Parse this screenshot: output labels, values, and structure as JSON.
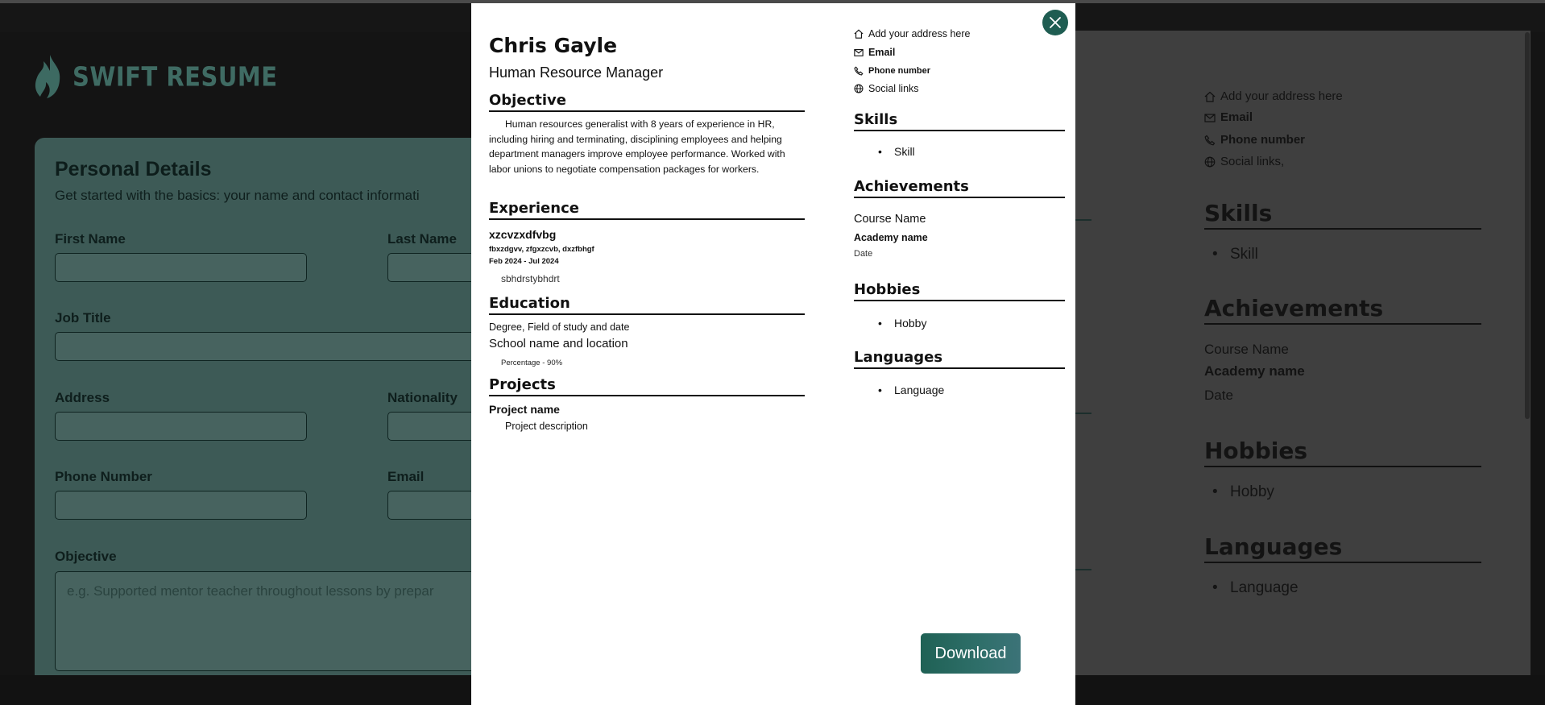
{
  "app": {
    "brand": "SWIFT RESUME"
  },
  "form": {
    "title": "Personal Details",
    "subtitle": "Get started with the basics: your name and contact informati",
    "fields": {
      "first_name": "First Name",
      "last_name": "Last Name",
      "job_title": "Job Title",
      "address": "Address",
      "nationality": "Nationality",
      "phone": "Phone Number",
      "email": "Email",
      "objective": "Objective"
    },
    "objective_placeholder": "e.g. Supported mentor teacher throughout lessons by prepar"
  },
  "preview": {
    "contact": {
      "address": "Add your address here",
      "email": "Email",
      "phone": "Phone number",
      "social": "Social links,"
    },
    "skills": {
      "heading": "Skills",
      "items": [
        "Skill"
      ]
    },
    "achievements": {
      "heading": "Achievements",
      "course": "Course Name",
      "academy": "Academy name",
      "date": "Date"
    },
    "hobbies": {
      "heading": "Hobbies",
      "items": [
        "Hobby"
      ]
    },
    "languages": {
      "heading": "Languages",
      "items": [
        "Language"
      ]
    }
  },
  "modal": {
    "name": "Chris Gayle",
    "role": "Human Resource Manager",
    "objective": {
      "heading": "Objective",
      "text": "Human resources generalist with 8 years of experience in HR, including hiring and terminating, disciplining employees and helping department managers improve employee performance. Worked with labor unions to negotiate compensation packages for workers."
    },
    "experience": {
      "heading": "Experience",
      "title": "xzcvzxdfvbg",
      "company": "fbxzdgvv, zfgxzcvb, dxzfbhgf",
      "dates": "Feb 2024 - Jul 2024",
      "description": "sbhdrstybhdrt"
    },
    "education": {
      "heading": "Education",
      "degree": "Degree, Field of study and date",
      "school": "School name and location",
      "percentage": "Percentage - 90%"
    },
    "projects": {
      "heading": "Projects",
      "name": "Project name",
      "description": "Project description"
    },
    "contact": {
      "address": "Add your address here",
      "email": "Email",
      "phone": "Phone number",
      "social": "Social links"
    },
    "skills": {
      "heading": "Skills",
      "items": [
        "Skill"
      ]
    },
    "achievements": {
      "heading": "Achievements",
      "course": "Course Name",
      "academy": "Academy name",
      "date": "Date"
    },
    "hobbies": {
      "heading": "Hobbies",
      "items": [
        "Hobby"
      ]
    },
    "languages": {
      "heading": "Languages",
      "items": [
        "Language"
      ]
    },
    "download_label": "Download"
  },
  "colors": {
    "accent": "#1f5d52",
    "form_bg": "#3d5a56"
  }
}
